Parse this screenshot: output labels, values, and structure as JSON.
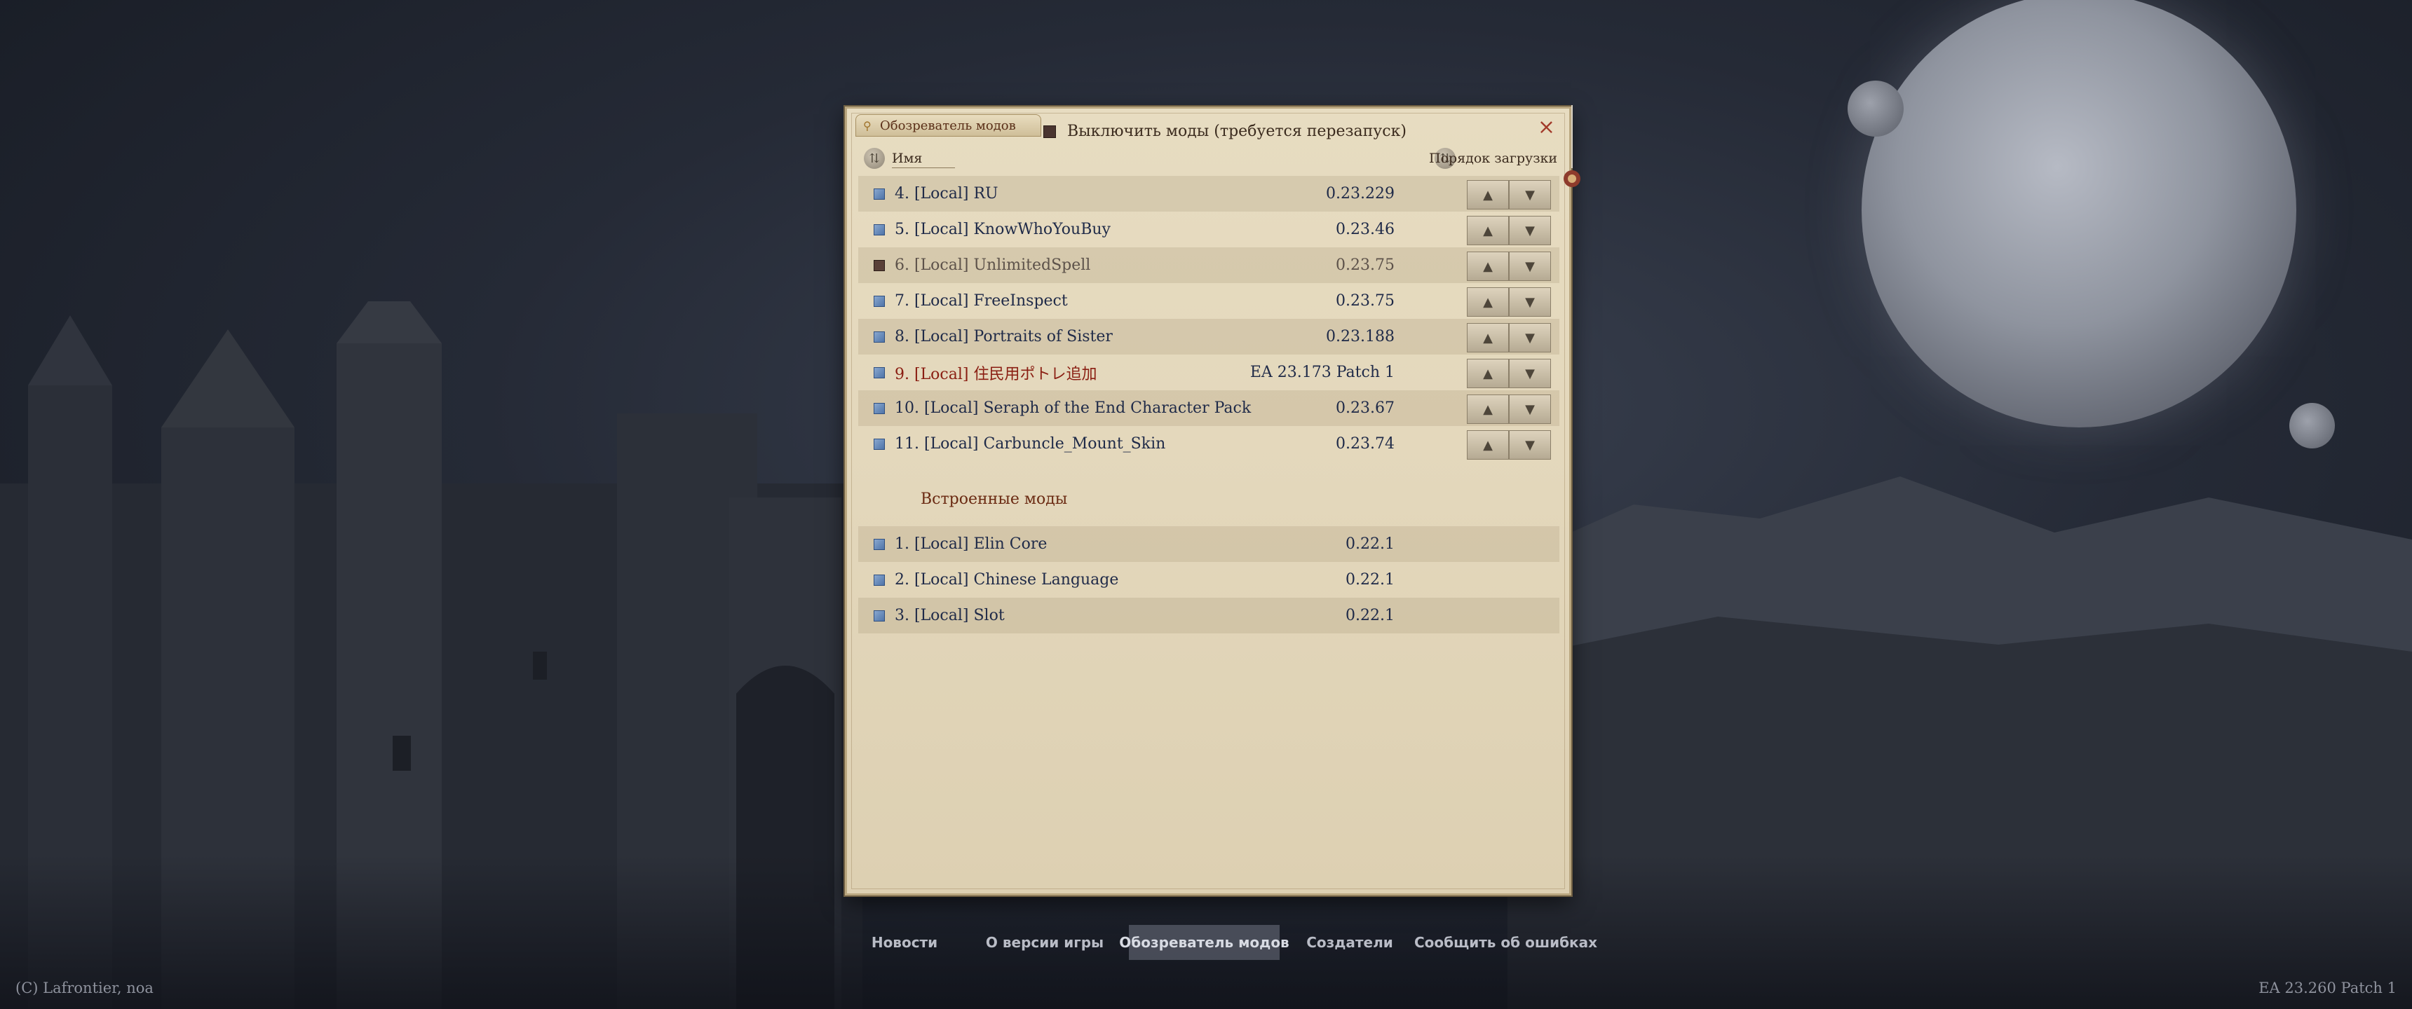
{
  "window": {
    "tab_label": "Обозреватель модов",
    "disable_mods_label": "Выключить моды (требуется перезапуск)",
    "close_symbol": "×"
  },
  "header": {
    "name_column": "Имя",
    "load_order_column": "Порядок загрузки"
  },
  "mods": [
    {
      "label": "4. [Local] RU",
      "version": "0.23.229",
      "enabled": true,
      "state": "normal"
    },
    {
      "label": "5. [Local] KnowWhoYouBuy",
      "version": "0.23.46",
      "enabled": true,
      "state": "normal"
    },
    {
      "label": "6. [Local] UnlimitedSpell",
      "version": "0.23.75",
      "enabled": false,
      "state": "disabled"
    },
    {
      "label": "7. [Local] FreeInspect",
      "version": "0.23.75",
      "enabled": true,
      "state": "normal"
    },
    {
      "label": "8. [Local] Portraits of Sister",
      "version": "0.23.188",
      "enabled": true,
      "state": "normal"
    },
    {
      "label": "9. [Local] 住民用ポトレ追加",
      "version": "EA 23.173 Patch 1",
      "enabled": true,
      "state": "error"
    },
    {
      "label": "10. [Local] Seraph of the End Character Pack",
      "version": "0.23.67",
      "enabled": true,
      "state": "normal"
    },
    {
      "label": "11. [Local] Carbuncle_Mount_Skin",
      "version": "0.23.74",
      "enabled": true,
      "state": "normal"
    }
  ],
  "builtin": {
    "title": "Встроенные моды",
    "mods": [
      {
        "label": "1. [Local] Elin Core",
        "version": "0.22.1"
      },
      {
        "label": "2. [Local] Chinese Language",
        "version": "0.22.1"
      },
      {
        "label": "3. [Local] Slot",
        "version": "0.22.1"
      }
    ]
  },
  "bottom_menu": [
    {
      "label": "Новости",
      "active": false
    },
    {
      "label": "О версии игры",
      "active": false
    },
    {
      "label": "Обозреватель модов",
      "active": true
    },
    {
      "label": "Создатели",
      "active": false
    },
    {
      "label": "Сообщить об ошибках",
      "active": false
    }
  ],
  "footer": {
    "copyright": "(C) Lafrontier, noa",
    "version": "EA 23.260 Patch 1"
  },
  "icons": {
    "up_arrow": "▲",
    "down_arrow": "▼",
    "sort": "⇅",
    "tab": "⚲"
  },
  "colors": {
    "panel": "#e3d7bb",
    "mod_text": "#1f2a48",
    "error_text": "#8a1e12",
    "section_title": "#6a2a12"
  }
}
